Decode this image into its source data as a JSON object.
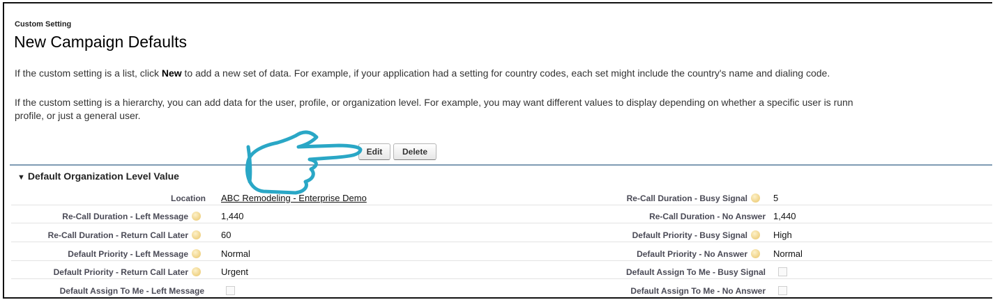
{
  "header": {
    "setting_type": "Custom Setting",
    "title": "New Campaign Defaults"
  },
  "description": {
    "para1_prefix": "If the custom setting is a list, click ",
    "para1_bold": "New",
    "para1_suffix": " to add a new set of data. For example, if your application had a setting for country codes, each set might include the country's name and dialing code.",
    "para2_line1": "If the custom setting is a hierarchy, you can add data for the user, profile, or organization level. For example, you may want different values to display depending on whether a specific user is runn",
    "para2_line2": "profile, or just a general user."
  },
  "buttons": {
    "edit": "Edit",
    "delete": "Delete"
  },
  "section": {
    "title": "Default Organization Level Value"
  },
  "fields": {
    "location_label": "Location",
    "location_value": "ABC Remodeling - Enterprise Demo",
    "recall_busy_label": "Re-Call Duration - Busy Signal",
    "recall_busy_value": "5",
    "recall_left_label": "Re-Call Duration - Left Message",
    "recall_left_value": "1,440",
    "recall_noanswer_label": "Re-Call Duration - No Answer",
    "recall_noanswer_value": "1,440",
    "recall_return_label": "Re-Call Duration - Return Call Later",
    "recall_return_value": "60",
    "priority_busy_label": "Default Priority - Busy Signal",
    "priority_busy_value": "High",
    "priority_left_label": "Default Priority - Left Message",
    "priority_left_value": "Normal",
    "priority_noanswer_label": "Default Priority - No Answer",
    "priority_noanswer_value": "Normal",
    "priority_return_label": "Default Priority - Return Call Later",
    "priority_return_value": "Urgent",
    "assign_busy_label": "Default Assign To Me - Busy Signal",
    "assign_busy_checked": false,
    "assign_left_label": "Default Assign To Me - Left Message",
    "assign_left_checked": false,
    "assign_noanswer_label": "Default Assign To Me - No Answer",
    "assign_noanswer_checked": false
  },
  "colors": {
    "annotation_hand": "#2aa7c6",
    "section_rule": "#7f9bb3",
    "help_icon": "#e9c467"
  },
  "icons": {
    "annotation": "pointing-hand-annotation-icon",
    "help": "help-bubble-icon",
    "collapse": "triangle-down-icon"
  }
}
